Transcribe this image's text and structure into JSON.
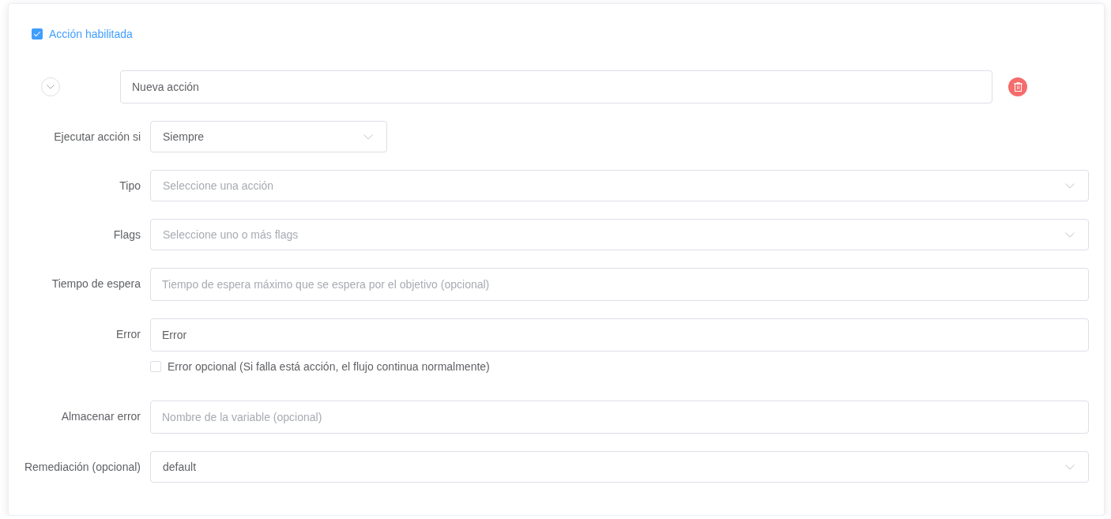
{
  "enabled": {
    "label": "Acción habilitada",
    "checked": true
  },
  "action_name": {
    "value": "Nueva acción"
  },
  "fields": [
    {
      "kind": "narrow-select",
      "label": "Ejecutar acción si",
      "value": "Siempre"
    },
    {
      "kind": "select",
      "label": "Tipo",
      "placeholder": "Seleccione una acción"
    },
    {
      "kind": "select",
      "label": "Flags",
      "placeholder": "Seleccione uno o más flags"
    },
    {
      "kind": "input",
      "label": "Tiempo de espera",
      "placeholder": "Tiempo de espera máximo que se espera por el objetivo (opcional)"
    },
    {
      "kind": "input",
      "label": "Error",
      "value": "Error",
      "option": {
        "label": "Error opcional (Si falla está acción, el flujo continua normalmente)",
        "checked": false
      }
    },
    {
      "kind": "input",
      "label": "Almacenar error",
      "placeholder": "Nombre de la variable (opcional)"
    },
    {
      "kind": "select",
      "label": "Remediación (opcional)",
      "value": "default"
    }
  ]
}
